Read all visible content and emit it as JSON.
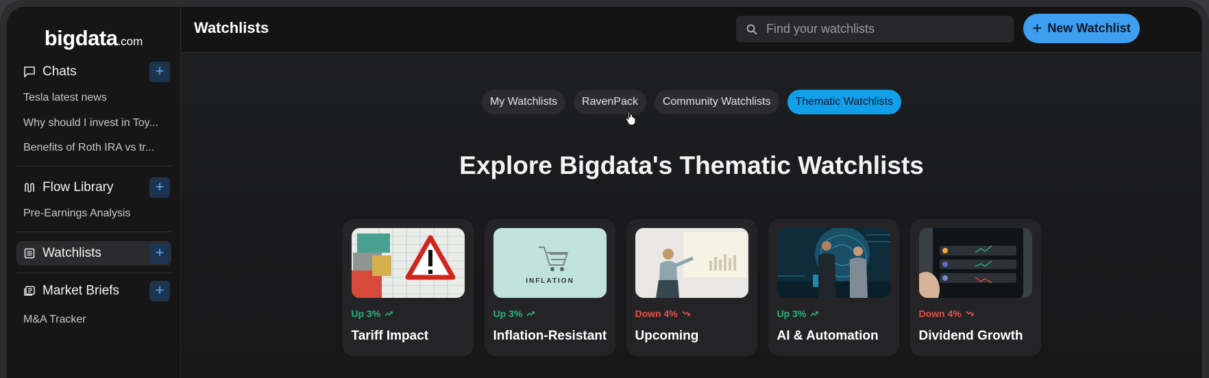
{
  "app": {
    "logo_main": "bigdata",
    "logo_suffix": ".com",
    "page_title": "Watchlists"
  },
  "sidebar": {
    "chats": {
      "title": "Chats",
      "icon": "chat-bubble-icon",
      "items": [
        "Tesla latest news",
        "Why should I invest in Toy...",
        "Benefits of Roth IRA vs tr..."
      ]
    },
    "flow_library": {
      "title": "Flow Library",
      "icon": "flow-icon",
      "items": [
        "Pre-Earnings Analysis"
      ]
    },
    "watchlists": {
      "title": "Watchlists",
      "icon": "list-icon",
      "active": true
    },
    "market_briefs": {
      "title": "Market Briefs",
      "icon": "newspaper-icon",
      "items": [
        "M&A Tracker"
      ]
    },
    "add_label": "+"
  },
  "topbar": {
    "search_placeholder": "Find your watchlists",
    "new_button": "New Watchlist",
    "new_button_icon": "+"
  },
  "tabs": [
    {
      "label": "My Watchlists",
      "active": false
    },
    {
      "label": "RavenPack",
      "active": false
    },
    {
      "label": "Community Watchlists",
      "active": false
    },
    {
      "label": "Thematic Watchlists",
      "active": true
    }
  ],
  "explore_title": "Explore Bigdata's Thematic Watchlists",
  "cards": [
    {
      "title": "Tariff Impact",
      "trend": "Up 3%",
      "direction": "up",
      "image": "shipping-containers-warning-image"
    },
    {
      "title": "Inflation-Resistant",
      "trend": "Up 3%",
      "direction": "up",
      "image": "inflation-shopping-cart-image",
      "image_text": "INFLATION"
    },
    {
      "title": "Upcoming",
      "trend": "Down 4%",
      "direction": "down",
      "image": "presentation-image"
    },
    {
      "title": "AI & Automation",
      "trend": "Up 3%",
      "direction": "up",
      "image": "ai-data-center-image"
    },
    {
      "title": "Dividend Growth",
      "trend": "Down 4%",
      "direction": "down",
      "image": "crypto-phone-image"
    }
  ],
  "colors": {
    "accent": "#3e9ef0",
    "tab_active": "#129fea",
    "up": "#2bb37a",
    "down": "#e2514c"
  }
}
